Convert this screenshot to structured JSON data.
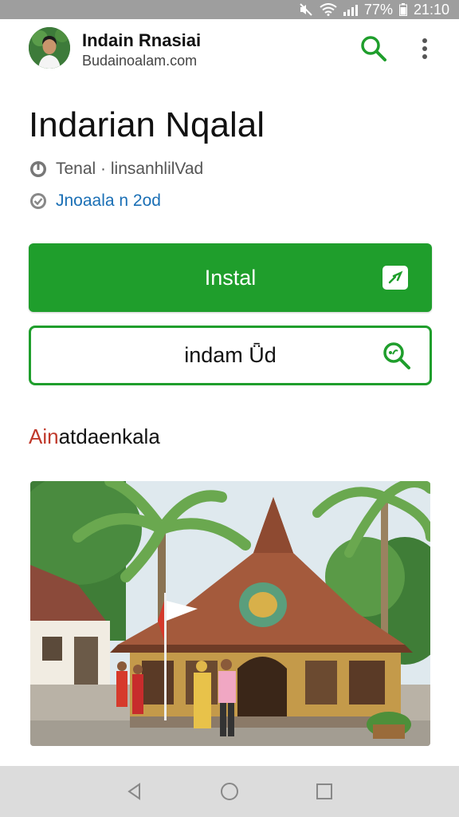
{
  "status_bar": {
    "battery": "77%",
    "time": "21:10",
    "icons": [
      "mute-icon",
      "wifi-icon",
      "signal-icon"
    ]
  },
  "header": {
    "app_name": "Indain Rnasiai",
    "app_url": "Budainoalam.com",
    "icons": [
      "avatar",
      "search-icon",
      "more-vert-icon"
    ]
  },
  "title": "Indarian Nqalal",
  "meta": {
    "line1": "Tenal · linsanhlilVad",
    "line2": "Jnoaala n 2od",
    "icons": [
      "clock-icon",
      "check-circle-icon"
    ]
  },
  "buttons": {
    "install_label": "Instal",
    "secondary_label": "indam Ǖd",
    "icons": [
      "install-badge-icon",
      "zoom-search-icon"
    ]
  },
  "section": {
    "heading_accent": "Ain",
    "heading_rest": "atdaenkala"
  },
  "colors": {
    "accent_green": "#1f9e2c",
    "link_blue": "#1a6fb5",
    "accent_red": "#c0392b"
  },
  "navbar": {
    "icons": [
      "back-icon",
      "home-icon",
      "recents-icon"
    ]
  }
}
